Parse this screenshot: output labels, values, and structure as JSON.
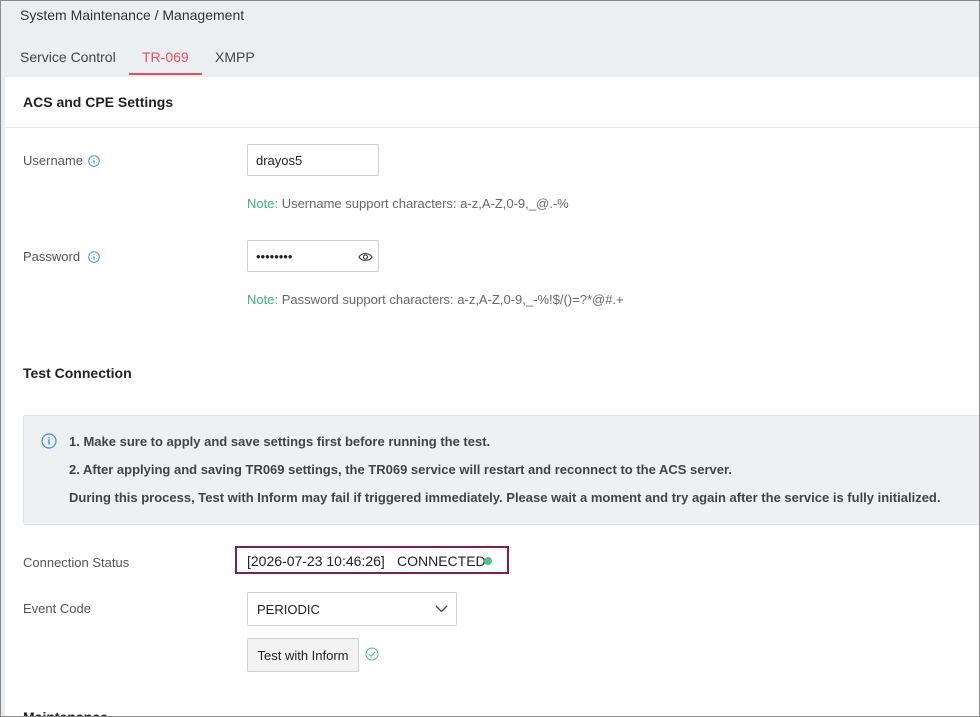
{
  "breadcrumb": "System Maintenance / Management",
  "tabs": [
    {
      "label": "Service Control",
      "active": false
    },
    {
      "label": "TR-069",
      "active": true
    },
    {
      "label": "XMPP",
      "active": false
    }
  ],
  "accent_color": "#e5505e",
  "acs_section": {
    "title": "ACS and CPE Settings",
    "username": {
      "label": "Username",
      "value": "drayos5",
      "note_key": "Note:",
      "note_text": " Username support characters: a-z,A-Z,0-9,_@.-%"
    },
    "password": {
      "label": "Password",
      "value": "dummypas",
      "note_key": "Note:",
      "note_text": " Password support characters: a-z,A-Z,0-9,_-%!$/()=?*@#.+"
    }
  },
  "test_section": {
    "title": "Test Connection",
    "info_lines": [
      "1. Make sure to apply and save settings first before running the test.",
      "2. After applying and saving TR069 settings, the TR069 service will restart and reconnect to the ACS server.",
      "During this process, Test with Inform may fail if triggered immediately. Please wait a moment and try again after the service is fully initialized."
    ],
    "connection_status": {
      "label": "Connection Status",
      "timestamp": "[2026-07-23 10:46:26]",
      "value": "CONNECTED",
      "dot_color": "#4cc38a"
    },
    "event_code": {
      "label": "Event Code",
      "selected": "PERIODIC"
    },
    "test_button": "Test with Inform"
  },
  "next_section_title": "Maintenance"
}
